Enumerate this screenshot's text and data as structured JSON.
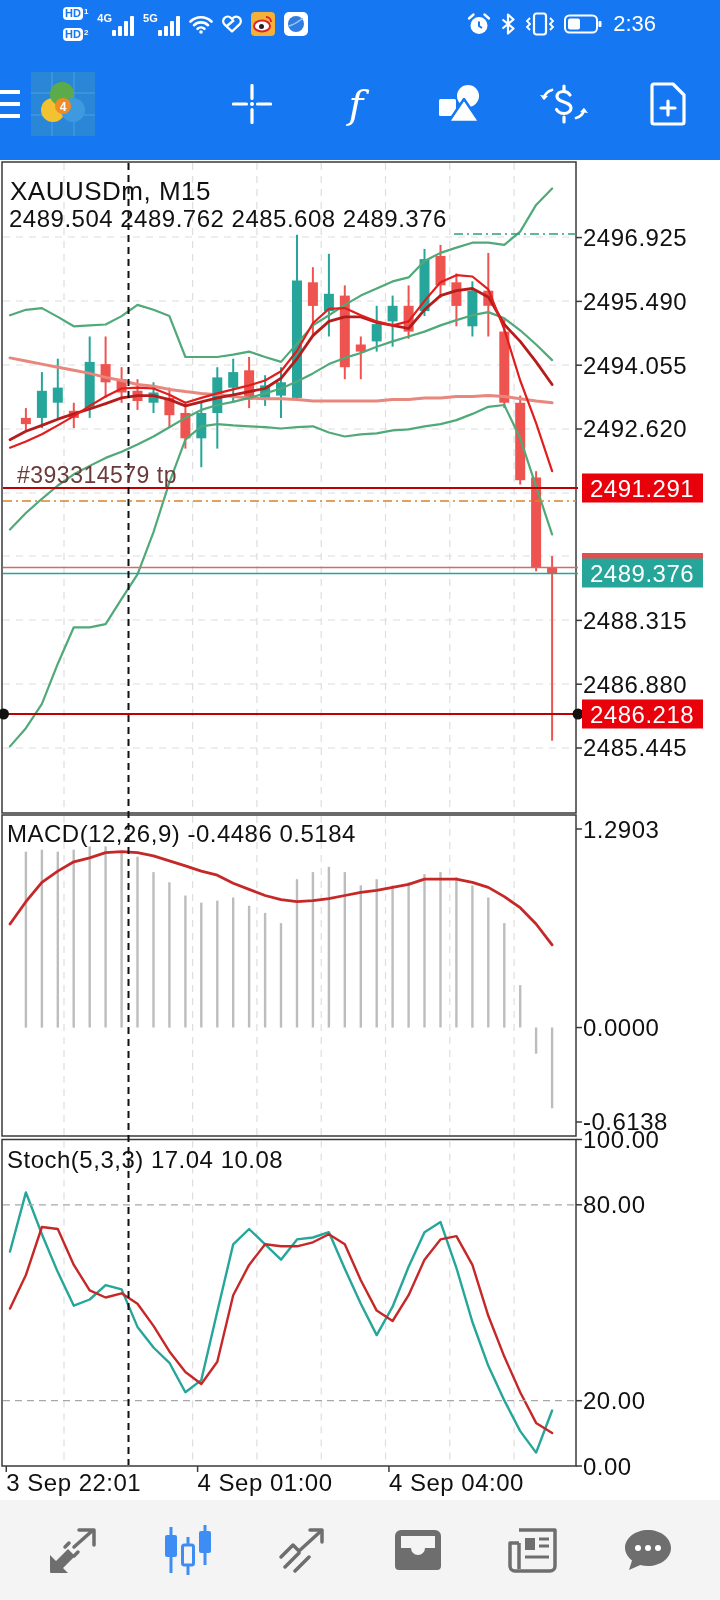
{
  "status_bar": {
    "hd_badges": [
      {
        "text": "HD",
        "slot": "1"
      },
      {
        "text": "HD",
        "slot": "2"
      }
    ],
    "networks": [
      "4G",
      "5G"
    ],
    "time": "2:36"
  },
  "toolbar": [
    {
      "kind": "menu"
    },
    {
      "kind": "logo",
      "badge": "4"
    },
    {
      "kind": "crosshair"
    },
    {
      "kind": "indicators",
      "label": "f"
    },
    {
      "kind": "objects"
    },
    {
      "kind": "trade"
    },
    {
      "kind": "new_document"
    }
  ],
  "chart": {
    "symbol": "XAUUSDm, M15",
    "ohlc": "2489.504 2489.762 2485.608 2489.376",
    "order_label": "#393314579 tp",
    "price_labels": [
      {
        "text": "2491.291",
        "color": "#e8000b"
      },
      {
        "text": "2489.376",
        "color": "#26a69a"
      },
      {
        "text": "2486.218",
        "color": "#e8000b"
      }
    ],
    "chart_data": {
      "type": "candlestick",
      "grid": true,
      "categories": [
        null,
        null,
        null,
        null,
        null,
        null,
        null,
        null,
        null,
        null,
        null,
        null,
        null,
        null,
        null,
        null,
        null,
        null,
        null,
        null,
        null,
        null,
        null,
        null,
        null,
        null,
        null,
        null,
        null,
        null,
        null,
        null,
        null,
        null,
        null,
        null
      ],
      "ylim": [
        2483.983,
        2498.625
      ],
      "yticks": [
        {
          "value": 2485.445,
          "label": "2485.445"
        },
        {
          "value": 2486.88,
          "label": "2486.880"
        },
        {
          "value": 2488.315,
          "label": "2488.315"
        },
        {
          "value": 2492.62,
          "label": "2492.620"
        },
        {
          "value": 2494.055,
          "label": "2494.055"
        },
        {
          "value": 2495.49,
          "label": "2495.490"
        },
        {
          "value": 2496.925,
          "label": "2496.925"
        }
      ],
      "ohlc": [
        null,
        [
          2492.87,
          2493.09,
          2492.59,
          2492.73
        ],
        [
          2492.87,
          2493.9,
          2492.64,
          2493.48
        ],
        [
          2493.21,
          2494.2,
          2492.87,
          2493.55
        ],
        [
          2493.03,
          2493.21,
          2492.64,
          2492.87
        ],
        [
          2493.09,
          2494.7,
          2492.87,
          2494.13
        ],
        [
          2494.08,
          2494.7,
          2493.32,
          2493.67
        ],
        [
          2493.74,
          2494.01,
          2493.21,
          2493.44
        ],
        [
          2493.48,
          2493.74,
          2493.05,
          2493.25
        ],
        [
          2493.21,
          2493.67,
          2492.98,
          2493.44
        ],
        [
          2493.32,
          2493.55,
          2492.64,
          2492.93
        ],
        [
          2492.98,
          2493.21,
          2492.18,
          2492.41
        ],
        [
          2492.41,
          2493.21,
          2491.76,
          2492.98
        ],
        [
          2492.98,
          2494.01,
          2492.18,
          2493.78
        ],
        [
          2493.55,
          2494.2,
          2493.21,
          2493.9
        ],
        [
          2493.94,
          2494.24,
          2493.09,
          2493.28
        ],
        [
          2493.32,
          2493.83,
          2493.14,
          2493.6
        ],
        [
          2493.37,
          2494.01,
          2492.87,
          2493.67
        ],
        [
          2493.32,
          2496.99,
          2493.28,
          2495.96
        ],
        [
          2495.92,
          2496.26,
          2494.7,
          2495.39
        ],
        [
          2495.27,
          2496.56,
          2494.7,
          2495.66
        ],
        [
          2495.62,
          2495.85,
          2493.74,
          2494.01
        ],
        [
          2494.52,
          2494.7,
          2493.74,
          2494.36
        ],
        [
          2494.59,
          2495.39,
          2494.36,
          2494.98
        ],
        [
          2495.04,
          2495.62,
          2494.47,
          2495.39
        ],
        [
          2495.39,
          2495.85,
          2494.65,
          2494.81
        ],
        [
          2495.27,
          2496.67,
          2495.16,
          2496.44
        ],
        [
          2496.51,
          2496.76,
          2495.57,
          2495.85
        ],
        [
          2495.92,
          2496.12,
          2494.93,
          2495.39
        ],
        [
          2494.93,
          2495.94,
          2494.7,
          2495.73
        ],
        [
          2495.73,
          2496.58,
          2494.7,
          2495.39
        ],
        [
          2494.81,
          2495.11,
          2493.09,
          2493.21
        ],
        [
          2493.21,
          2493.37,
          2491.37,
          2491.47
        ],
        [
          2491.53,
          2491.67,
          2489.42,
          2489.5
        ],
        [
          2489.5,
          2489.76,
          2485.61,
          2489.38
        ],
        null
      ],
      "series": [
        {
          "type": "line",
          "color": "#e8877d",
          "values": [
            2494.22,
            2494.15,
            2494.08,
            2494.01,
            2493.94,
            2493.87,
            2493.78,
            2493.71,
            2493.62,
            2493.58,
            2493.51,
            2493.46,
            2493.42,
            2493.39,
            2493.35,
            2493.32,
            2493.3,
            2493.3,
            2493.28,
            2493.25,
            2493.25,
            2493.25,
            2493.25,
            2493.25,
            2493.28,
            2493.28,
            2493.32,
            2493.32,
            2493.35,
            2493.35,
            2493.37,
            2493.35,
            2493.3,
            2493.25,
            2493.21,
            null
          ]
        },
        {
          "type": "line",
          "color": "#4fa978",
          "values": [
            2495.18,
            2495.3,
            2495.34,
            2495.14,
            2494.93,
            2494.95,
            2494.97,
            2495.16,
            2495.41,
            2495.3,
            2495.16,
            2494.24,
            2494.24,
            2494.24,
            2494.29,
            2494.36,
            2494.24,
            2494.13,
            2494.54,
            2494.95,
            2495.18,
            2495.41,
            2495.62,
            2495.78,
            2495.94,
            2496.03,
            2496.4,
            2496.58,
            2496.7,
            2496.81,
            2496.81,
            2496.76,
            2497.06,
            2497.66,
            2498.03,
            null
          ]
        },
        {
          "type": "line",
          "color": "#4fa978",
          "values": [
            2490.36,
            2490.73,
            2491.05,
            2491.35,
            2491.6,
            2491.79,
            2491.97,
            2492.11,
            2492.27,
            2492.45,
            2492.66,
            2492.87,
            2493.05,
            2493.16,
            2493.23,
            2493.32,
            2493.42,
            2493.53,
            2493.69,
            2493.87,
            2494.08,
            2494.22,
            2494.33,
            2494.47,
            2494.59,
            2494.7,
            2494.81,
            2494.95,
            2495.07,
            2495.18,
            2495.25,
            2495.11,
            2494.84,
            2494.52,
            2494.17,
            null
          ]
        },
        {
          "type": "line",
          "color": "#4fa978",
          "values": [
            2485.48,
            2485.89,
            2486.44,
            2487.34,
            2488.16,
            2488.16,
            2488.23,
            2488.8,
            2489.35,
            2490.3,
            2491.42,
            2492.38,
            2492.68,
            2492.73,
            2492.7,
            2492.68,
            2492.66,
            2492.63,
            2492.66,
            2492.68,
            2492.54,
            2492.45,
            2492.5,
            2492.52,
            2492.59,
            2492.61,
            2492.68,
            2492.73,
            2492.82,
            2492.96,
            2493.12,
            2493.16,
            2492.41,
            2491.33,
            2490.25,
            null
          ]
        },
        {
          "type": "line",
          "color": "#b71c1c",
          "values": [
            2492.38,
            2492.57,
            2492.7,
            2492.84,
            2492.96,
            2493.07,
            2493.19,
            2493.32,
            2493.37,
            2493.37,
            2493.28,
            2493.14,
            2493.23,
            2493.32,
            2493.39,
            2493.46,
            2493.53,
            2493.76,
            2494.2,
            2494.72,
            2495.04,
            2495.14,
            2495.14,
            2495.02,
            2494.95,
            2494.88,
            2495.3,
            2495.62,
            2495.73,
            2495.78,
            2495.59,
            2494.97,
            2494.59,
            2494.13,
            2493.62,
            null
          ]
        },
        {
          "type": "line",
          "color": "#e01e1e",
          "values": [
            2492.2,
            2492.34,
            2492.5,
            2492.7,
            2492.91,
            2493.14,
            2493.35,
            2493.53,
            2493.55,
            2493.53,
            2493.39,
            2493.21,
            2493.32,
            2493.42,
            2493.51,
            2493.6,
            2493.71,
            2493.92,
            2494.38,
            2495.0,
            2495.32,
            2495.34,
            2495.18,
            2495.04,
            2494.95,
            2495.04,
            2495.5,
            2495.92,
            2496.08,
            2496.05,
            2495.76,
            2494.86,
            2493.71,
            2492.75,
            2491.67,
            null
          ]
        }
      ]
    }
  },
  "macd": {
    "title": "MACD(12,26,9) -0.4486 0.5184",
    "chart_data": {
      "type": "bar",
      "grid": true,
      "categories": [
        null,
        null,
        null,
        null,
        null,
        null,
        null,
        null,
        null,
        null,
        null,
        null,
        null,
        null,
        null,
        null,
        null,
        null,
        null,
        null,
        null,
        null,
        null,
        null,
        null,
        null,
        null,
        null,
        null,
        null,
        null,
        null,
        null,
        null,
        null,
        null
      ],
      "ylim": [
        -0.7048,
        1.3813
      ],
      "yticks": [
        {
          "value": -0.6138,
          "label": "-0.6138"
        },
        {
          "value": 0,
          "label": "0.0000"
        },
        {
          "value": 1.2903,
          "label": "1.2903"
        }
      ],
      "series": [
        {
          "color": "#bdbdbd",
          "values": [
            null,
            1.143,
            1.156,
            1.143,
            1.156,
            1.177,
            1.177,
            1.143,
            1.11,
            1.01,
            0.944,
            0.858,
            0.812,
            0.825,
            0.845,
            0.791,
            0.745,
            0.679,
            0.964,
            1.01,
            1.044,
            1.01,
            0.924,
            0.964,
            0.924,
            0.944,
            0.997,
            1.01,
            0.977,
            0.924,
            0.845,
            0.679,
            0.275,
            -0.17,
            -0.525,
            null
          ]
        },
        {
          "type": "line",
          "color": "#c62828",
          "values": [
            0.673,
            0.818,
            0.944,
            1.017,
            1.077,
            1.103,
            1.136,
            1.143,
            1.136,
            1.116,
            1.083,
            1.051,
            1.017,
            0.99,
            0.938,
            0.898,
            0.858,
            0.831,
            0.818,
            0.825,
            0.838,
            0.858,
            0.878,
            0.891,
            0.911,
            0.931,
            0.964,
            0.964,
            0.964,
            0.944,
            0.911,
            0.851,
            0.779,
            0.673,
            0.538,
            null
          ]
        }
      ]
    }
  },
  "stochastic": {
    "title": "Stoch(5,3,3) 17.04 10.08",
    "chart_data": {
      "type": "line",
      "grid": true,
      "categories": [
        null,
        null,
        null,
        null,
        "3 Sep 22:01",
        null,
        null,
        null,
        null,
        null,
        null,
        null,
        null,
        null,
        null,
        null,
        "4 Sep 01:00",
        null,
        null,
        null,
        null,
        null,
        null,
        null,
        null,
        null,
        null,
        null,
        "4 Sep 04:00",
        null,
        null,
        null,
        null,
        null,
        null,
        null
      ],
      "ylim": [
        0,
        100
      ],
      "yticks": [
        {
          "value": 0,
          "label": "0.00"
        },
        {
          "value": 20,
          "label": "20.00"
        },
        {
          "value": 80,
          "label": "80.00"
        },
        {
          "value": 100,
          "label": "100.00"
        }
      ],
      "series": [
        {
          "color": "#26a69a",
          "values": [
            65.7,
            83.8,
            71.0,
            59.4,
            49.1,
            51.0,
            55.4,
            54.1,
            42.6,
            36.3,
            31.6,
            22.6,
            26.3,
            47.3,
            67.9,
            72.6,
            67.9,
            63.2,
            69.4,
            70.0,
            71.6,
            60.4,
            49.7,
            40.1,
            48.8,
            61.0,
            71.6,
            74.7,
            60.7,
            44.1,
            30.7,
            20.1,
            10.7,
            4.1,
            17.0,
            null
          ]
        },
        {
          "color": "#c62828",
          "values": [
            48.2,
            58.5,
            73.2,
            72.6,
            61.6,
            53.8,
            51.6,
            52.9,
            49.7,
            42.9,
            35.1,
            28.8,
            25.1,
            31.9,
            52.3,
            61.6,
            67.9,
            67.3,
            67.3,
            68.5,
            71.0,
            67.9,
            56.9,
            47.6,
            44.4,
            52.3,
            63.2,
            69.4,
            70.4,
            61.6,
            46.0,
            33.5,
            22.6,
            13.2,
            10.1,
            null
          ]
        }
      ]
    }
  },
  "bottom_nav": [
    {
      "kind": "quotes",
      "selected": false
    },
    {
      "kind": "chart",
      "selected": true
    },
    {
      "kind": "trade",
      "selected": false
    },
    {
      "kind": "history",
      "selected": false
    },
    {
      "kind": "news",
      "selected": false
    },
    {
      "kind": "chat",
      "selected": false
    }
  ]
}
